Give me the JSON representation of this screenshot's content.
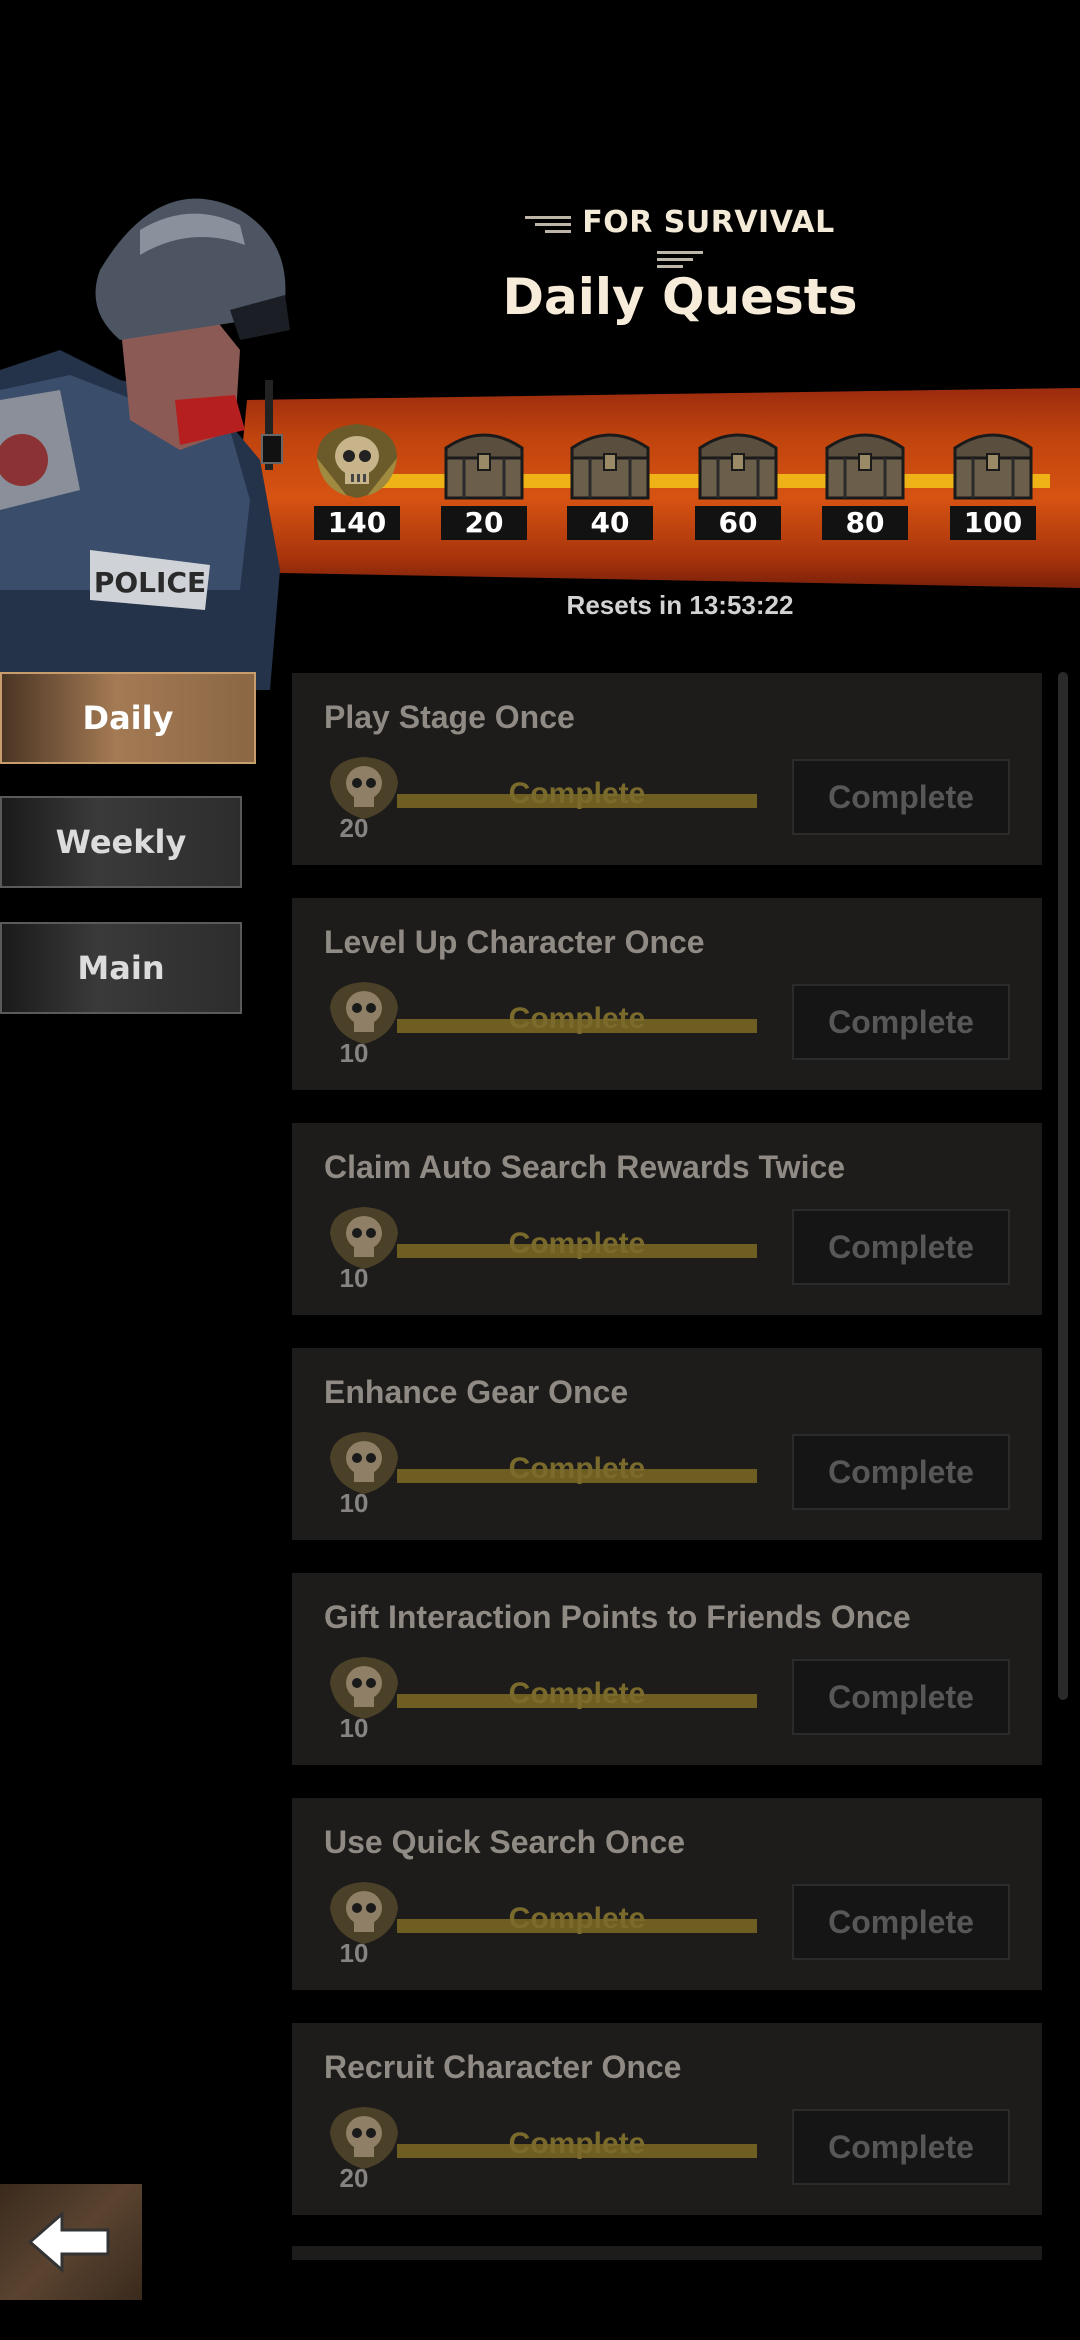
{
  "header": {
    "subtitle": "FOR SURVIVAL",
    "title": "Daily Quests"
  },
  "rewards": {
    "points": "140",
    "milestones": [
      "20",
      "40",
      "60",
      "80",
      "100"
    ],
    "reset_text": "Resets in 13:53:22",
    "bar_color": "#f0b317",
    "band_color": "#c1440e"
  },
  "tabs": [
    {
      "label": "Daily",
      "active": true
    },
    {
      "label": "Weekly",
      "active": false
    },
    {
      "label": "Main",
      "active": false
    }
  ],
  "quests": [
    {
      "title": "Play Stage Once",
      "reward": "20",
      "bar_label": "Complete",
      "button": "Complete"
    },
    {
      "title": "Level Up Character Once",
      "reward": "10",
      "bar_label": "Complete",
      "button": "Complete"
    },
    {
      "title": "Claim Auto Search Rewards Twice",
      "reward": "10",
      "bar_label": "Complete",
      "button": "Complete"
    },
    {
      "title": "Enhance Gear Once",
      "reward": "10",
      "bar_label": "Complete",
      "button": "Complete"
    },
    {
      "title": "Gift Interaction Points to Friends Once",
      "reward": "10",
      "bar_label": "Complete",
      "button": "Complete"
    },
    {
      "title": "Use Quick Search Once",
      "reward": "10",
      "bar_label": "Complete",
      "button": "Complete"
    },
    {
      "title": "Recruit Character Once",
      "reward": "20",
      "bar_label": "Complete",
      "button": "Complete"
    }
  ],
  "icons": {
    "back": "back-arrow-icon",
    "points": "skull-medal-icon",
    "chest": "treasure-chest-icon"
  }
}
